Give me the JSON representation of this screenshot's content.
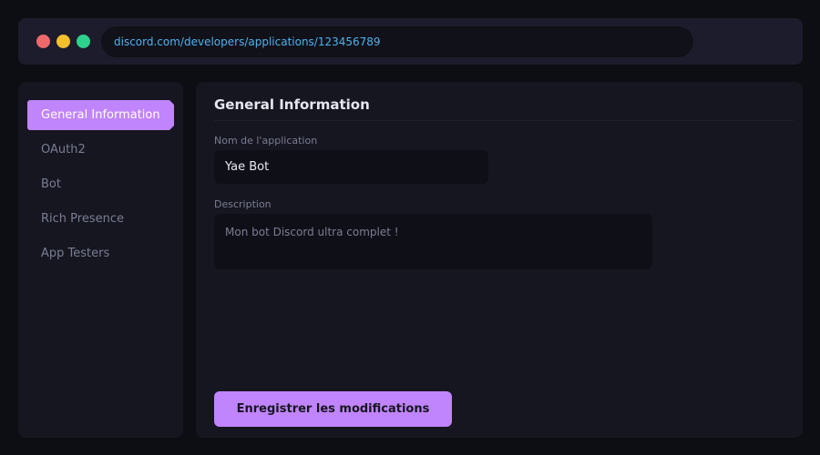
{
  "browser": {
    "url": "discord.com/developers/applications/123456789",
    "controls": [
      "close",
      "minimize",
      "maximize"
    ]
  },
  "sidebar": {
    "items": [
      {
        "label": "General Information",
        "active": true
      },
      {
        "label": "OAuth2",
        "active": false
      },
      {
        "label": "Bot",
        "active": false
      },
      {
        "label": "Rich Presence",
        "active": false
      },
      {
        "label": "App Testers",
        "active": false
      }
    ]
  },
  "main": {
    "title": "General Information",
    "fields": {
      "name": {
        "label": "Nom de l'application",
        "value": "Yae Bot"
      },
      "description": {
        "label": "Description",
        "value": "Mon bot Discord ultra complet !"
      }
    },
    "save_label": "Enregistrer les modifications"
  },
  "colors": {
    "accent": "#c084fc",
    "url_text": "#4fb2ee",
    "background": "#0d0d14",
    "panel": "#161620",
    "window_close": "#ee6a6a",
    "window_minimize": "#f5c02e",
    "window_maximize": "#2fd28c"
  }
}
